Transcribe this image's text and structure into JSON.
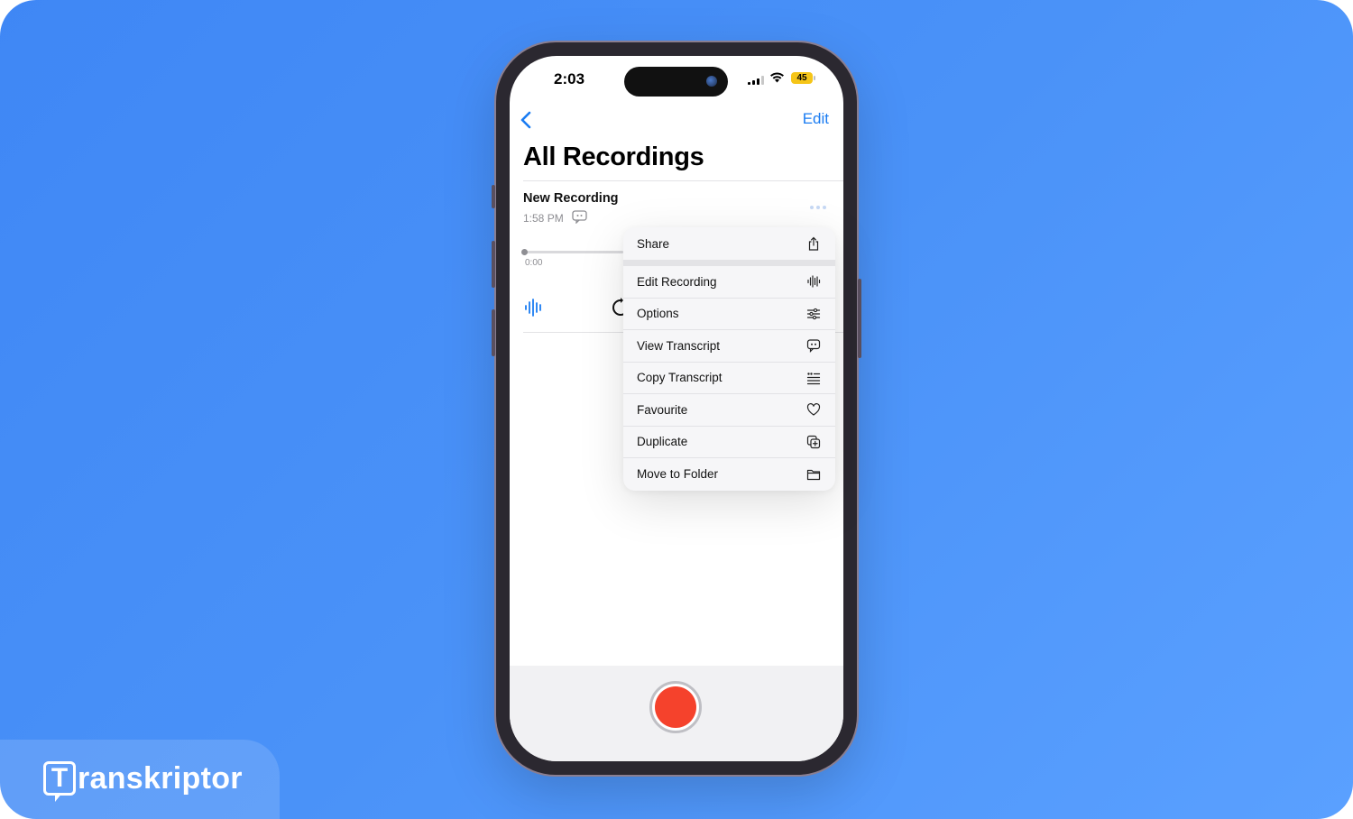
{
  "brand": {
    "name": "ranskriptor",
    "mark_letter": "T"
  },
  "status_bar": {
    "time": "2:03",
    "battery": "45"
  },
  "nav": {
    "edit_label": "Edit"
  },
  "page": {
    "title": "All Recordings"
  },
  "recording": {
    "title": "New Recording",
    "time": "1:58 PM",
    "position": "0:00"
  },
  "menu": {
    "items": [
      {
        "label": "Share",
        "icon": "share-icon"
      },
      {
        "label": "Edit Recording",
        "icon": "waveform-icon"
      },
      {
        "label": "Options",
        "icon": "sliders-icon"
      },
      {
        "label": "View Transcript",
        "icon": "transcript-bubble-icon"
      },
      {
        "label": "Copy Transcript",
        "icon": "quote-lines-icon"
      },
      {
        "label": "Favourite",
        "icon": "heart-icon"
      },
      {
        "label": "Duplicate",
        "icon": "duplicate-icon"
      },
      {
        "label": "Move to Folder",
        "icon": "folder-icon"
      }
    ]
  },
  "colors": {
    "background": "#4a92f8",
    "accent": "#1a7cf2",
    "record": "#f5422c",
    "battery": "#f5c518"
  }
}
